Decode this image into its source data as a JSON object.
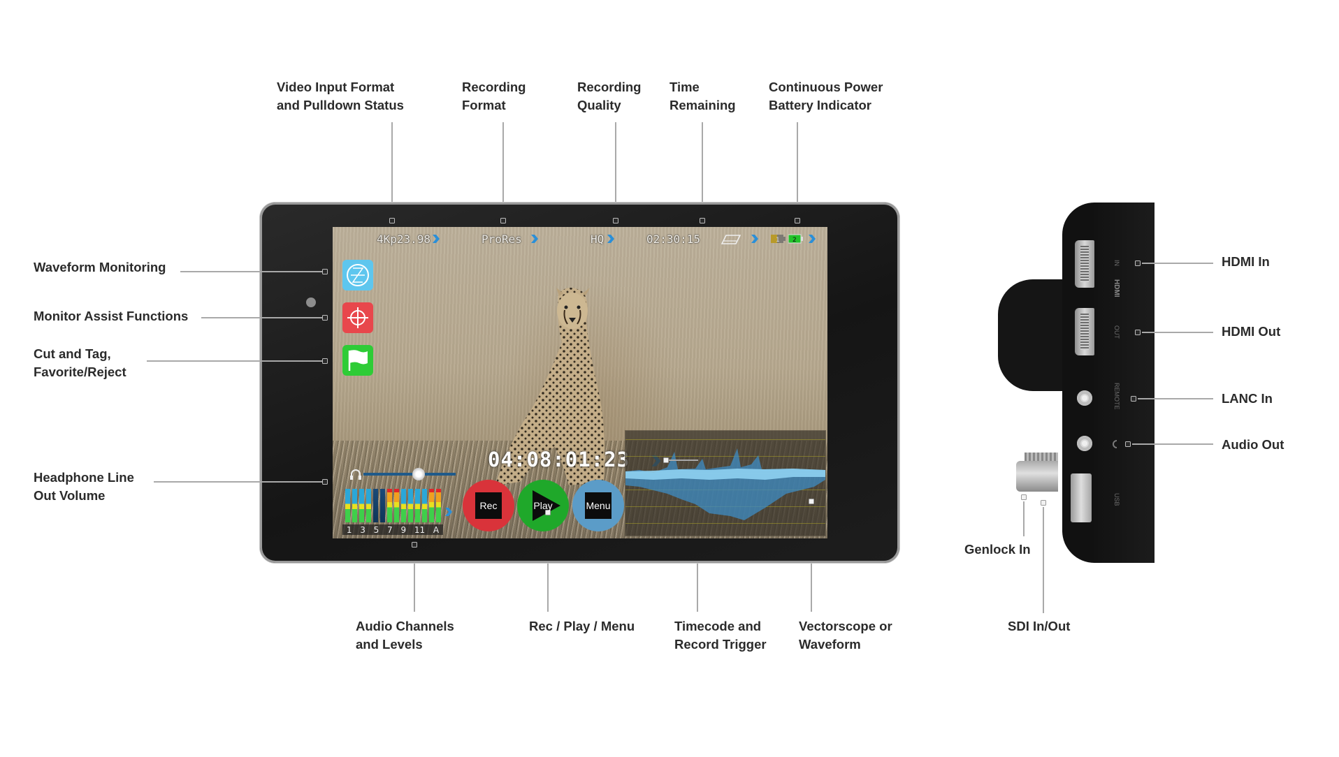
{
  "callouts": {
    "top": [
      {
        "line1": "Video Input Format",
        "line2": "and Pulldown Status"
      },
      {
        "line1": "Recording",
        "line2": "Format"
      },
      {
        "line1": "Recording",
        "line2": "Quality"
      },
      {
        "line1": "Time",
        "line2": "Remaining"
      },
      {
        "line1": "Continuous Power",
        "line2": "Battery Indicator"
      }
    ],
    "left": [
      {
        "line1": "Waveform  Monitoring",
        "line2": ""
      },
      {
        "line1": "Monitor Assist Functions",
        "line2": ""
      },
      {
        "line1": "Cut and Tag,",
        "line2": "Favorite/Reject"
      },
      {
        "line1": "Headphone Line",
        "line2": "Out Volume"
      }
    ],
    "bottom": [
      {
        "line1": "Audio Channels",
        "line2": "and Levels"
      },
      {
        "line1": "Rec / Play / Menu",
        "line2": ""
      },
      {
        "line1": "Timecode and",
        "line2": "Record Trigger"
      },
      {
        "line1": "Vectorscope or",
        "line2": "Waveform"
      }
    ],
    "right": [
      {
        "line1": "HDMI In"
      },
      {
        "line1": "HDMI Out"
      },
      {
        "line1": "LANC In"
      },
      {
        "line1": "Audio Out"
      }
    ],
    "side_bottom": [
      {
        "line1": "Genlock In"
      },
      {
        "line1": "SDI In/Out"
      }
    ]
  },
  "screen": {
    "status_bar": {
      "input_format": "4Kp23.98",
      "recording_format": "ProRes",
      "recording_quality": "HQ",
      "time_remaining": "02:30:15",
      "media_icon": "disk-drive-icon",
      "battery_1": {
        "label": "1",
        "level": 0.5,
        "color": "#b89a2a"
      },
      "battery_2": {
        "label": "2",
        "level": 1.0,
        "color": "#22c42a"
      }
    },
    "side_buttons": [
      {
        "icon": "waveform-scope-icon",
        "color": "#5ec6ee"
      },
      {
        "icon": "crosshair-target-icon",
        "color": "#e8474c"
      },
      {
        "icon": "flag-icon",
        "color": "#2ecc36"
      }
    ],
    "timecode": "04:08:01:23",
    "controls": [
      {
        "label": "Rec",
        "color": "#d9333a"
      },
      {
        "label": "Play",
        "color": "#1fa82a"
      },
      {
        "label": "Menu",
        "color": "#5b9cc8"
      }
    ],
    "headphone_volume": 0.6,
    "audio_channel_labels": [
      "1",
      "3",
      "5",
      "7",
      "9",
      "11",
      "A"
    ],
    "accent_color": "#2a8fd8"
  },
  "side_panel": {
    "hdmi_label": "HDMI",
    "in_label": "IN",
    "out_label": "OUT",
    "remote_label": "REMOTE",
    "usb_label": "USB"
  }
}
